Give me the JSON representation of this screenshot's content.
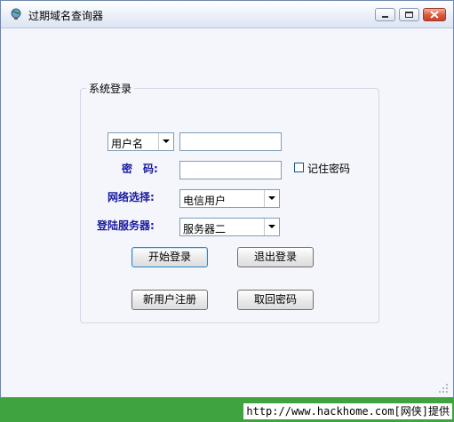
{
  "window": {
    "title": "过期域名查询器"
  },
  "login_group": {
    "title": "系统登录",
    "user_type": {
      "selected": "用户名"
    },
    "password_label": "密　码:",
    "remember_label": "记住密码",
    "network": {
      "label": "网络选择:",
      "selected": "电信用户"
    },
    "server": {
      "label": "登陆服务器:",
      "selected": "服务器二"
    },
    "buttons": {
      "login": "开始登录",
      "exit": "退出登录",
      "register": "新用户注册",
      "recover": "取回密码"
    }
  },
  "footer": {
    "text": "http://www.hackhome.com[网侠]提供"
  },
  "colors": {
    "label_blue": "#1a1aa0",
    "footer_green": "#3fa33f"
  },
  "icons": {
    "app": "globe-icon",
    "dropdown": "chevron-down-icon"
  }
}
